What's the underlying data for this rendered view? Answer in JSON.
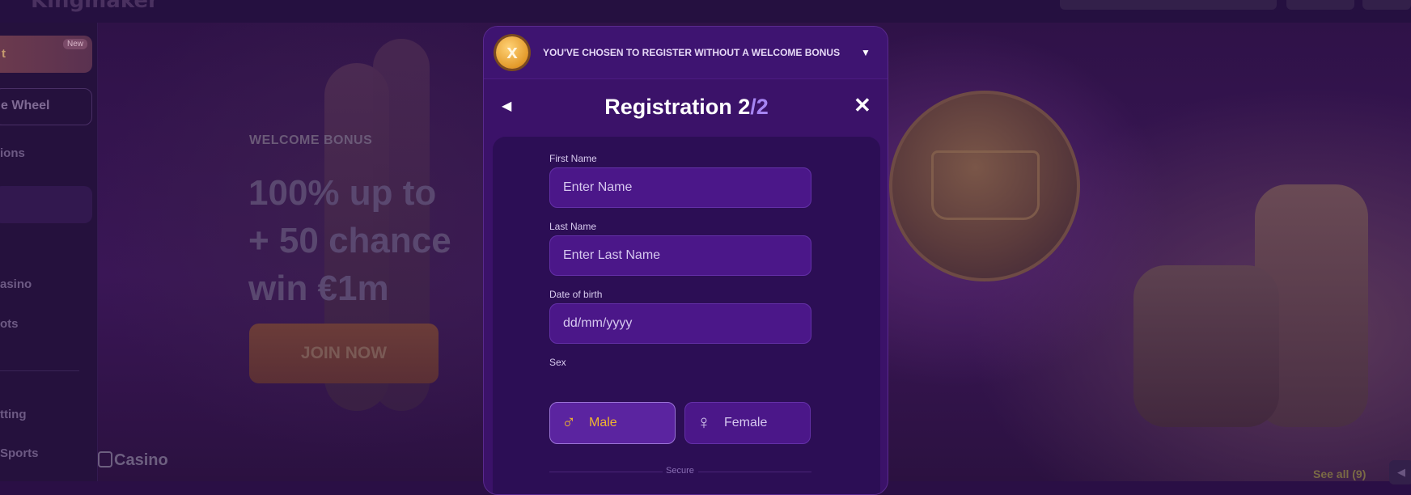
{
  "brand": {
    "name": "Kingmaker"
  },
  "sidebar": {
    "promo": {
      "label": "t",
      "badge": "New"
    },
    "items": [
      {
        "label": "e Wheel"
      },
      {
        "label": "ions"
      },
      {
        "label": "asino"
      },
      {
        "label": "ots"
      },
      {
        "label": "tting"
      },
      {
        "label": "Sports"
      }
    ]
  },
  "hero": {
    "subtitle": "WELCOME BONUS",
    "line1": "100% up to",
    "line2": "+ 50 chance",
    "line3": "win €1m",
    "cta": "JOIN NOW"
  },
  "casino_section": {
    "title": "Casino",
    "see_all": "See all (9)"
  },
  "modal": {
    "banner_text": "YOU'VE CHOSEN TO REGISTER WITHOUT A WELCOME BONUS",
    "banner_toggle_icon": "triangle-down",
    "bonus_icon": "x",
    "title_main": "Registration 2",
    "title_sep": "/",
    "title_total": "2",
    "fields": {
      "first_name": {
        "label": "First Name",
        "placeholder": "Enter Name"
      },
      "last_name": {
        "label": "Last Name",
        "placeholder": "Enter Last Name"
      },
      "dob": {
        "label": "Date of birth",
        "placeholder": "dd/mm/yyyy"
      }
    },
    "sex": {
      "label": "Sex",
      "options": [
        {
          "label": "Male",
          "icon": "male-symbol",
          "selected": true
        },
        {
          "label": "Female",
          "icon": "female-symbol",
          "selected": false
        }
      ]
    },
    "secure_text": "Secure"
  },
  "colors": {
    "accent_gold": "#f0b52e",
    "title_accent": "#a685f2",
    "modal_bg": "#3b1269",
    "input_bg": "#4b1789"
  }
}
